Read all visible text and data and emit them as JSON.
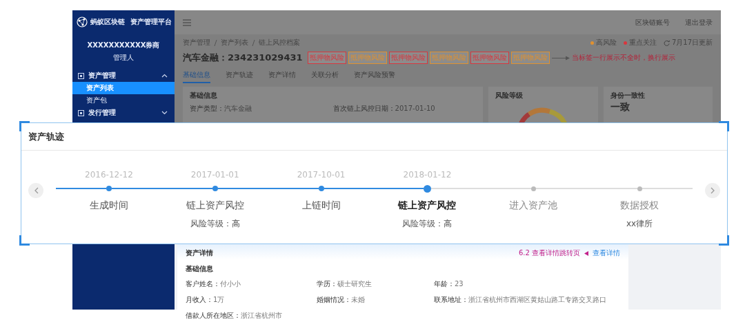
{
  "sidebar": {
    "brand": "蚂蚁区块链",
    "product": "资产管理平台",
    "account": {
      "name": "XXXXXXXXXXX券商",
      "role": "管理人"
    },
    "menu": [
      {
        "label": "资产管理",
        "expanded": true,
        "children": [
          {
            "label": "资产列表",
            "selected": true
          },
          {
            "label": "资产包",
            "selected": false
          }
        ]
      },
      {
        "label": "发行管理",
        "expanded": false
      }
    ]
  },
  "header": {
    "links": [
      "区块链账号",
      "退出登录"
    ]
  },
  "breadcrumb": [
    "资产管理",
    "资产列表",
    "链上风控档案"
  ],
  "legend": [
    {
      "label": "高风险",
      "color": "#e0912f"
    },
    {
      "label": "重点关注",
      "color": "#d9363e"
    }
  ],
  "update_note": "7月17日更新",
  "title": "汽车金融：234231029431",
  "tags": [
    {
      "label": "抵押物风险",
      "color": "#d9363e"
    },
    {
      "label": "抵押物风险",
      "color": "#e0912f"
    },
    {
      "label": "抵押物风险",
      "color": "#d9363e"
    },
    {
      "label": "抵押物风险",
      "color": "#e0912f"
    },
    {
      "label": "抵押物风险",
      "color": "#d9363e"
    },
    {
      "label": "抵押物风险",
      "color": "#e0912f"
    }
  ],
  "annotation": "当标签一行展示不全时，换行展示",
  "tabs": [
    {
      "label": "基础信息",
      "selected": true
    },
    {
      "label": "资产轨迹",
      "selected": false
    },
    {
      "label": "资产详情",
      "selected": false
    },
    {
      "label": "关联分析",
      "selected": false
    },
    {
      "label": "资产风险预警",
      "selected": false
    }
  ],
  "basic_card": {
    "title": "基础信息",
    "fields": [
      {
        "label": "资产类型：",
        "value": "汽车金融"
      },
      {
        "label": "首次链上风控日期：",
        "value": "2017-01-10"
      }
    ]
  },
  "risk_card": {
    "title": "风险等级"
  },
  "identity_card": {
    "title": "身份一致性",
    "value": "一致"
  },
  "trajectory": {
    "title": "资产轨迹",
    "steps": [
      {
        "date": "2016-12-12",
        "label": "生成时间",
        "completed": true,
        "selected": false
      },
      {
        "date": "2017-01-01",
        "label": "链上资产风控",
        "note": "风险等级：高",
        "completed": true,
        "selected": false
      },
      {
        "date": "2017-10-01",
        "label": "上链时间",
        "completed": true,
        "selected": false
      },
      {
        "date": "2018-01-12",
        "label": "链上资产风控",
        "note": "风险等级：高",
        "completed": false,
        "selected": true
      },
      {
        "label": "进入资产池",
        "completed": false,
        "selected": false
      },
      {
        "label": "数据授权",
        "note": "xx律所",
        "completed": false,
        "selected": false
      }
    ]
  },
  "details": {
    "title": "资产详情",
    "annotation": "6.2 查看详情跳转页",
    "link": "查看详情",
    "section": "基础信息",
    "fields": [
      {
        "label": "客户姓名：",
        "value": "付小小"
      },
      {
        "label": "学历：",
        "value": "硕士研究生"
      },
      {
        "label": "年龄：",
        "value": "23"
      },
      {
        "label": "月收入：",
        "value": "1万"
      },
      {
        "label": "婚姻情况：",
        "value": "未婚"
      },
      {
        "label": "联系地址：",
        "value": "浙江省杭州市西湖区黄姑山路工专路交叉路口"
      },
      {
        "label": "借款人所在地区：",
        "value": "浙江省杭州市"
      }
    ]
  }
}
